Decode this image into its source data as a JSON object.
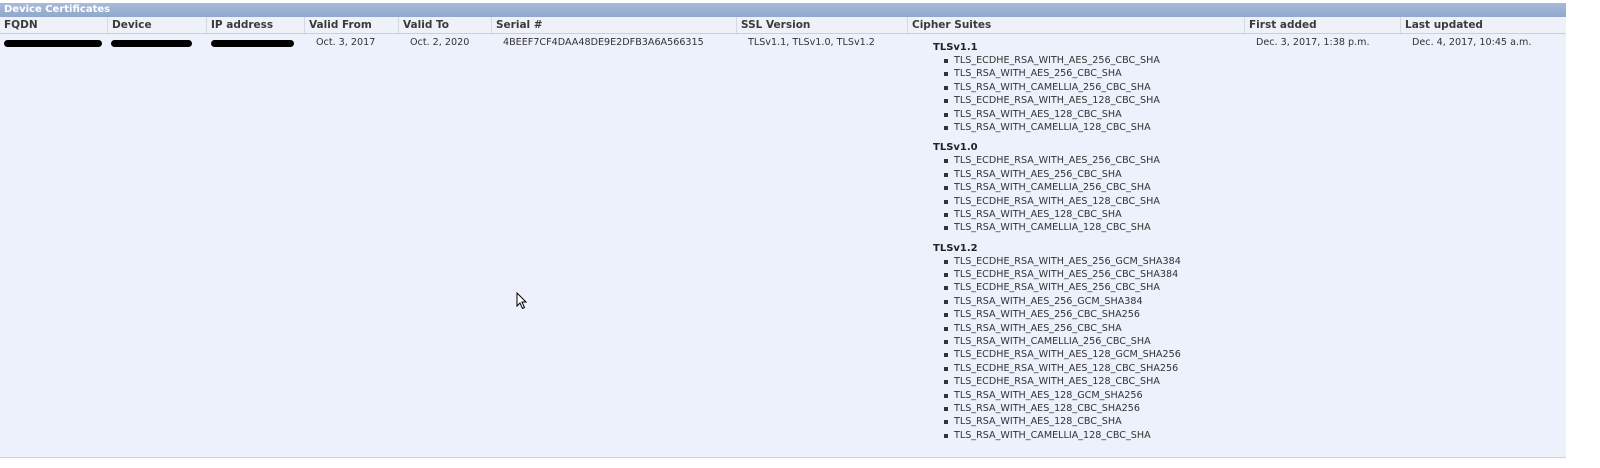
{
  "panel": {
    "title": "Device Certificates"
  },
  "columns": [
    "FQDN",
    "Device",
    "IP address",
    "Valid From",
    "Valid To",
    "Serial #",
    "SSL Version",
    "Cipher Suites",
    "First added",
    "Last updated"
  ],
  "row": {
    "fqdn": "",
    "device": "",
    "ip_address": "",
    "valid_from": "Oct. 3, 2017",
    "valid_to": "Oct. 2, 2020",
    "serial": "4BEEF7CF4DAA48DE9E2DFB3A6A566315",
    "ssl_version": "TLSv1.1, TLSv1.0, TLSv1.2",
    "first_added": "Dec. 3, 2017, 1:38 p.m.",
    "last_updated": "Dec. 4, 2017, 10:45 a.m."
  },
  "cipher_groups": [
    {
      "name": "TLSv1.1",
      "suites": [
        "TLS_ECDHE_RSA_WITH_AES_256_CBC_SHA",
        "TLS_RSA_WITH_AES_256_CBC_SHA",
        "TLS_RSA_WITH_CAMELLIA_256_CBC_SHA",
        "TLS_ECDHE_RSA_WITH_AES_128_CBC_SHA",
        "TLS_RSA_WITH_AES_128_CBC_SHA",
        "TLS_RSA_WITH_CAMELLIA_128_CBC_SHA"
      ]
    },
    {
      "name": "TLSv1.0",
      "suites": [
        "TLS_ECDHE_RSA_WITH_AES_256_CBC_SHA",
        "TLS_RSA_WITH_AES_256_CBC_SHA",
        "TLS_RSA_WITH_CAMELLIA_256_CBC_SHA",
        "TLS_ECDHE_RSA_WITH_AES_128_CBC_SHA",
        "TLS_RSA_WITH_AES_128_CBC_SHA",
        "TLS_RSA_WITH_CAMELLIA_128_CBC_SHA"
      ]
    },
    {
      "name": "TLSv1.2",
      "suites": [
        "TLS_ECDHE_RSA_WITH_AES_256_GCM_SHA384",
        "TLS_ECDHE_RSA_WITH_AES_256_CBC_SHA384",
        "TLS_ECDHE_RSA_WITH_AES_256_CBC_SHA",
        "TLS_RSA_WITH_AES_256_GCM_SHA384",
        "TLS_RSA_WITH_AES_256_CBC_SHA256",
        "TLS_RSA_WITH_AES_256_CBC_SHA",
        "TLS_RSA_WITH_CAMELLIA_256_CBC_SHA",
        "TLS_ECDHE_RSA_WITH_AES_128_GCM_SHA256",
        "TLS_ECDHE_RSA_WITH_AES_128_CBC_SHA256",
        "TLS_ECDHE_RSA_WITH_AES_128_CBC_SHA",
        "TLS_RSA_WITH_AES_128_GCM_SHA256",
        "TLS_RSA_WITH_AES_128_CBC_SHA256",
        "TLS_RSA_WITH_AES_128_CBC_SHA",
        "TLS_RSA_WITH_CAMELLIA_128_CBC_SHA"
      ]
    }
  ],
  "icons": {
    "cursor": "mouse-pointer-icon"
  }
}
